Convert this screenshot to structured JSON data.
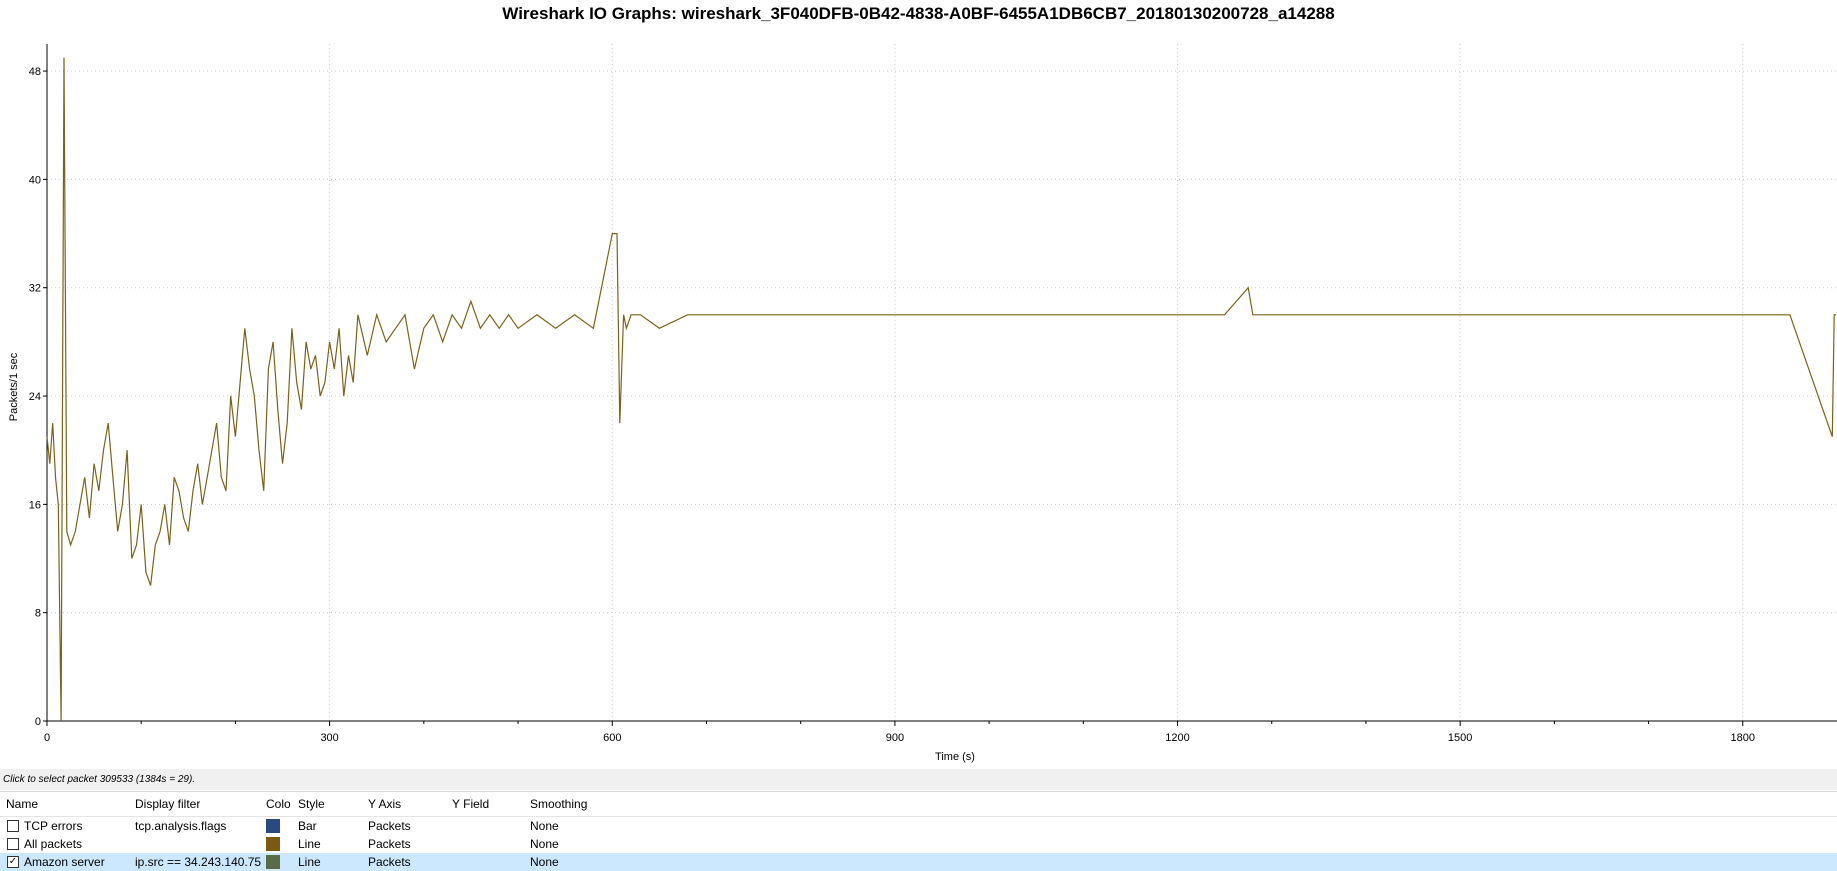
{
  "window": {
    "title": "Wireshark IO Graphs: wireshark_3F040DFB-0B42-4838-A0BF-6455A1DB6CB7_20180130200728_a14288"
  },
  "chart_data": {
    "type": "line",
    "xlabel": "Time (s)",
    "ylabel": "Packets/1 sec",
    "xlim": [
      0,
      1900
    ],
    "ylim": [
      0,
      50
    ],
    "x_ticks": [
      "0",
      "300",
      "600",
      "900",
      "1200",
      "1500",
      "1800"
    ],
    "y_ticks": [
      "0",
      "8",
      "16",
      "24",
      "32",
      "40",
      "48"
    ],
    "grid": true,
    "series": [
      {
        "name": "Amazon server",
        "color": "#7a6318",
        "x": [
          0,
          3,
          6,
          9,
          12,
          15,
          18,
          21,
          25,
          30,
          35,
          40,
          45,
          50,
          55,
          60,
          65,
          70,
          75,
          80,
          85,
          90,
          95,
          100,
          105,
          110,
          115,
          120,
          125,
          130,
          135,
          140,
          145,
          150,
          155,
          160,
          165,
          170,
          175,
          180,
          185,
          190,
          195,
          200,
          205,
          210,
          215,
          220,
          225,
          230,
          235,
          240,
          245,
          250,
          255,
          260,
          265,
          270,
          275,
          280,
          285,
          290,
          295,
          300,
          305,
          310,
          315,
          320,
          325,
          330,
          340,
          350,
          360,
          370,
          380,
          390,
          400,
          410,
          420,
          430,
          440,
          450,
          460,
          470,
          480,
          490,
          500,
          520,
          540,
          560,
          580,
          600,
          605,
          608,
          612,
          615,
          620,
          630,
          650,
          680,
          700,
          750,
          800,
          850,
          900,
          950,
          1000,
          1050,
          1100,
          1150,
          1200,
          1250,
          1275,
          1280,
          1300,
          1350,
          1400,
          1450,
          1500,
          1550,
          1600,
          1650,
          1700,
          1750,
          1800,
          1850,
          1895,
          1897,
          1899
        ],
        "values": [
          21,
          19,
          22,
          18,
          16,
          0,
          49,
          14,
          13,
          14,
          16,
          18,
          15,
          19,
          17,
          20,
          22,
          18,
          14,
          16,
          20,
          12,
          13,
          16,
          11,
          10,
          13,
          14,
          16,
          13,
          18,
          17,
          15,
          14,
          17,
          19,
          16,
          18,
          20,
          22,
          18,
          17,
          24,
          21,
          25,
          29,
          26,
          24,
          20,
          17,
          26,
          28,
          23,
          19,
          22,
          29,
          25,
          23,
          28,
          26,
          27,
          24,
          25,
          28,
          26,
          29,
          24,
          27,
          25,
          30,
          27,
          30,
          28,
          29,
          30,
          26,
          29,
          30,
          28,
          30,
          29,
          31,
          29,
          30,
          29,
          30,
          29,
          30,
          29,
          30,
          29,
          36,
          36,
          22,
          30,
          29,
          30,
          30,
          29,
          30,
          30,
          30,
          30,
          30,
          30,
          30,
          30,
          30,
          30,
          30,
          30,
          30,
          32,
          30,
          30,
          30,
          30,
          30,
          30,
          30,
          30,
          30,
          30,
          30,
          30,
          30,
          21,
          30,
          30
        ]
      }
    ]
  },
  "status": {
    "text": "Click to select packet 309533 (1384s = 29)."
  },
  "graph_table": {
    "headers": {
      "name": "Name",
      "filter": "Display filter",
      "color": "Color",
      "style": "Style",
      "yaxis": "Y Axis",
      "yfield": "Y Field",
      "smoothing": "Smoothing"
    },
    "rows": [
      {
        "checked": false,
        "check_mark": "",
        "name": "TCP errors",
        "filter": "tcp.analysis.flags",
        "color": "#2a4a7f",
        "style": "Bar",
        "yaxis": "Packets",
        "yfield": "",
        "smoothing": "None"
      },
      {
        "checked": false,
        "check_mark": "",
        "name": "All packets",
        "filter": "",
        "color": "#7a5a10",
        "style": "Line",
        "yaxis": "Packets",
        "yfield": "",
        "smoothing": "None"
      },
      {
        "checked": true,
        "check_mark": "✓",
        "name": "Amazon server",
        "filter": "ip.src == 34.243.140.75",
        "color": "#5a6b4a",
        "style": "Line",
        "yaxis": "Packets",
        "yfield": "",
        "smoothing": "None"
      }
    ]
  }
}
